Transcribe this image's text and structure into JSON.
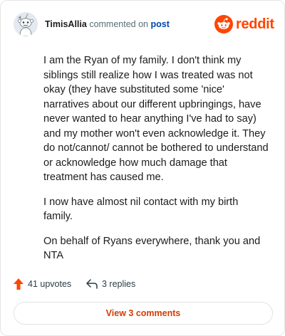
{
  "header": {
    "username": "TimisAllia",
    "verb": "commented on",
    "link_text": "post",
    "brand": "reddit",
    "icons": {
      "avatar": "snoo-avatar-icon",
      "logo": "reddit-logo-icon"
    },
    "colors": {
      "brand": "#ff4500",
      "link": "#0045ac"
    }
  },
  "comment": {
    "paragraphs": [
      "I am the Ryan of my family. I don't think my siblings still realize how I was treated was not okay (they have substituted some 'nice' narratives about our different upbringings, have never wanted to hear anything I've had to say) and my mother won't even acknowledge it. They do not/cannot/ cannot be bothered to understand or acknowledge how much damage that treatment has caused me.",
      "I now have almost nil contact with my birth family.",
      "On behalf of Ryans everywhere, thank you and NTA"
    ]
  },
  "actions": {
    "upvotes_label": "41 upvotes",
    "replies_label": "3 replies",
    "icons": {
      "upvote": "upvote-arrow-icon",
      "reply": "reply-arrow-icon"
    },
    "colors": {
      "upvote": "#ff4500"
    }
  },
  "footer": {
    "view_comments_label": "View 3 comments",
    "colors": {
      "button_text": "#d93900"
    }
  }
}
